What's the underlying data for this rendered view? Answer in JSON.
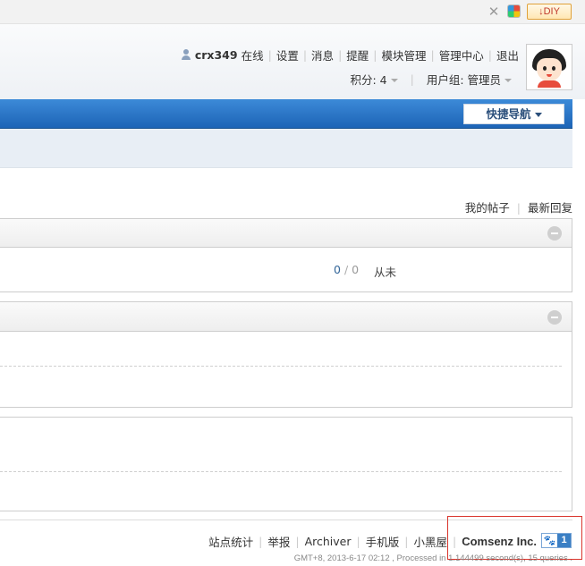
{
  "toolbar": {
    "diy_label": "↓DIY"
  },
  "user": {
    "name": "crx349",
    "status": "在线",
    "links": [
      "设置",
      "消息",
      "提醒",
      "模块管理",
      "管理中心",
      "退出"
    ],
    "points_label": "积分: 4",
    "group_label": "用户组: 管理员"
  },
  "nav": {
    "quick_nav_label": "快捷导航"
  },
  "posts": {
    "my_posts": "我的帖子",
    "latest_reply": "最新回复"
  },
  "panel1": {
    "count_a": "0",
    "count_b": "0",
    "last_post": "从未"
  },
  "footer": {
    "links": [
      "站点统计",
      "举报",
      "Archiver",
      "手机版",
      "小黑屋"
    ],
    "brand": "Comsenz Inc.",
    "badge_count": "1",
    "gmt_text": "GMT+8, 2013-6-17 02:12 , Processed in 1.144499 second(s), 15 queries ."
  },
  "colors": {
    "nav_blue": "#1d64b6",
    "highlight_red": "#d9342b"
  }
}
